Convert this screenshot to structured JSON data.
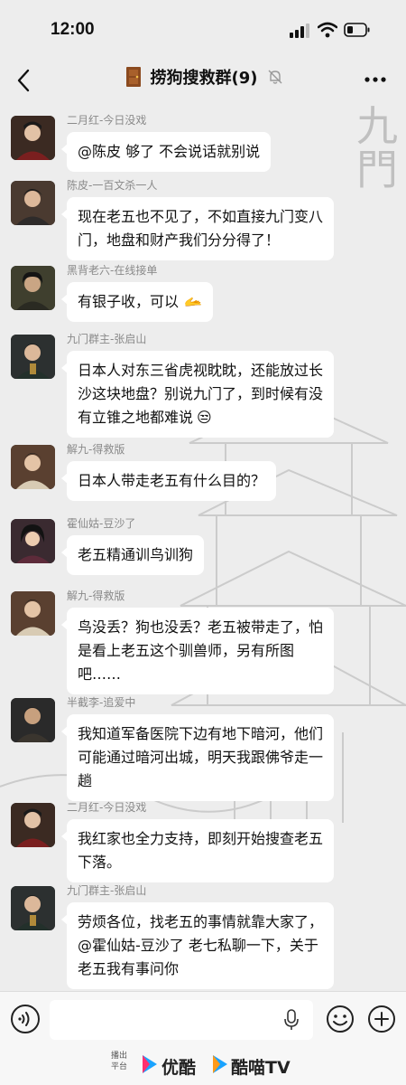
{
  "status_bar": {
    "time": "12:00"
  },
  "header": {
    "title": "捞狗搜救群(9)"
  },
  "background": {
    "calligraphy": "九門"
  },
  "messages": [
    {
      "sender": "二月红-今日没戏",
      "text": "@陈皮 够了 不会说话就别说",
      "avatar_color": "#3b2a22"
    },
    {
      "sender": "陈皮-一百文杀一人",
      "text": "现在老五也不见了，不如直接九门变八门，地盘和财产我们分分得了！",
      "avatar_color": "#4a3a30"
    },
    {
      "sender": "黑背老六-在线接单",
      "text": "有银子收，可以",
      "avatar_color": "#3f3f2e",
      "emoji": "🫴"
    },
    {
      "sender": "九门群主-张启山",
      "text": "日本人对东三省虎视眈眈，还能放过长沙这块地盘？别说九门了，到时候有没有立锥之地都难说",
      "avatar_color": "#2c3030",
      "emoji": "😒"
    },
    {
      "sender": "解九-得救版",
      "text": "日本人带走老五有什么目的？",
      "avatar_color": "#5a4030"
    },
    {
      "sender": "霍仙姑-豆沙了",
      "text": "老五精通训鸟训狗",
      "avatar_color": "#3a2a30"
    },
    {
      "sender": "解九-得救版",
      "text": "鸟没丢？狗也没丢？老五被带走了，怕是看上老五这个驯兽师，另有所图吧……",
      "avatar_color": "#5a4030"
    },
    {
      "sender": "半截李-追爱中",
      "text": "我知道军备医院下边有地下暗河，他们可能通过暗河出城，明天我跟佛爷走一趟",
      "avatar_color": "#2a2a2a"
    },
    {
      "sender": "二月红-今日没戏",
      "text": "我红家也全力支持，即刻开始搜查老五下落。",
      "avatar_color": "#3b2a22"
    },
    {
      "sender": "九门群主-张启山",
      "text": "劳烦各位，找老五的事情就靠大家了，@霍仙姑-豆沙了 老七私聊一下，关于老五我有事问你",
      "avatar_color": "#2c3030"
    }
  ],
  "input": {
    "placeholder": ""
  },
  "footer": {
    "platform_label": "播出平台",
    "platform_1": "优酷",
    "platform_2": "酷喵TV"
  },
  "colors": {
    "background": "#ededed",
    "bubble": "#ffffff",
    "sender_text": "#8a8a8a",
    "youku_blue": "#1aa3ff"
  }
}
